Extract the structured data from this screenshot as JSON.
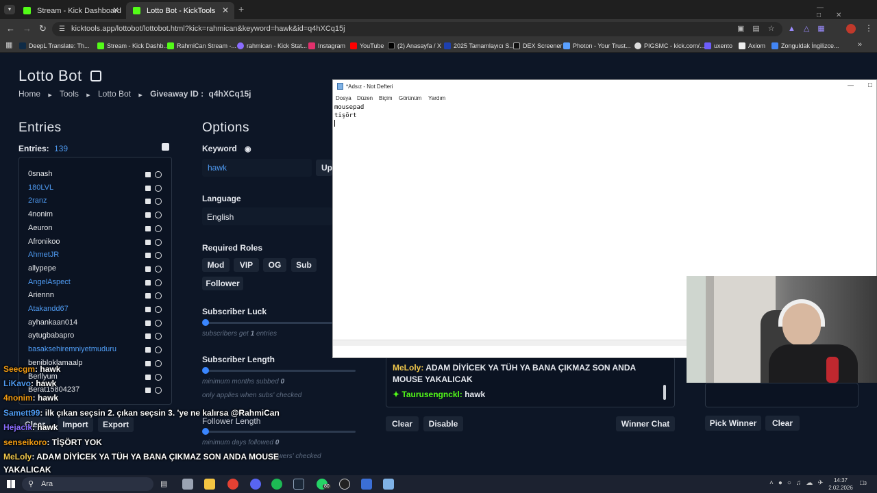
{
  "browser": {
    "tabs": [
      {
        "label": "Stream - Kick Dashboard"
      },
      {
        "label": "Lotto Bot - KickTools"
      }
    ],
    "url": "kicktools.app/lottobot/lottobot.html?kick=rahmican&keyword=hawk&id=q4hXCq15j",
    "bookmarks": [
      "DeepL Translate: Th...",
      "Stream - Kick Dashb...",
      "RahmiCan Stream -...",
      "rahmican - Kick Stat...",
      "Instagram",
      "YouTube",
      "(2) Anasayfa / X",
      "2025 Tamamlayıcı S...",
      "DEX Screener",
      "Photon - Your Trust...",
      "PIGSMC - kick.com/...",
      "uxento",
      "Axiom",
      "Zonguldak İngilizce..."
    ]
  },
  "app": {
    "title": "Lotto Bot",
    "breadcrumb": {
      "home": "Home",
      "tools": "Tools",
      "lotto": "Lotto Bot",
      "giveaway_label": "Giveaway ID :",
      "giveaway_id": "q4hXCq15j"
    },
    "entries": {
      "heading": "Entries",
      "count_label": "Entries:",
      "count": "139",
      "list": [
        {
          "name": "0snash",
          "blue": false
        },
        {
          "name": "180LVL",
          "blue": true
        },
        {
          "name": "2ranz",
          "blue": true
        },
        {
          "name": "4nonim",
          "blue": false
        },
        {
          "name": "Aeuron",
          "blue": false
        },
        {
          "name": "Afronikoo",
          "blue": false
        },
        {
          "name": "AhmetJR",
          "blue": true
        },
        {
          "name": "allypepe",
          "blue": false
        },
        {
          "name": "AngelAspect",
          "blue": true
        },
        {
          "name": "Ariennn",
          "blue": false
        },
        {
          "name": "Atakandd67",
          "blue": true
        },
        {
          "name": "ayhankaan014",
          "blue": false
        },
        {
          "name": "aytugbabapro",
          "blue": false
        },
        {
          "name": "basaksehiremniyetmuduru",
          "blue": true
        },
        {
          "name": "benibloklamaalp",
          "blue": false
        },
        {
          "name": "Berllyum",
          "blue": false
        },
        {
          "name": "Berat15804237",
          "blue": false
        }
      ],
      "buttons": {
        "clear": "Clear",
        "import": "Import",
        "export": "Export"
      }
    },
    "options": {
      "heading": "Options",
      "keyword_label": "Keyword",
      "keyword_value": "hawk",
      "update_label": "Up",
      "language_label": "Language",
      "language_value": "English",
      "roles_label": "Required Roles",
      "roles": [
        "Mod",
        "VIP",
        "OG",
        "Sub",
        "Follower"
      ],
      "sub_luck_label": "Subscriber Luck",
      "sub_luck_hint_pre": "subscribers get",
      "sub_luck_value": "1",
      "sub_luck_hint_post": "entries",
      "sub_length_label": "Subscriber Length",
      "sub_length_hint": "minimum months subbed",
      "sub_length_value": "0",
      "sub_length_hint2": "only applies when subs' checked",
      "follower_length_label": "Follower Length",
      "follower_length_hint": "minimum days followed",
      "follower_length_value": "0",
      "follower_length_hint2": "flowers' checked"
    },
    "chat": {
      "msg1_user": "MeLoly:",
      "msg1_text": "ADAM DİYİCEK YA TÜH YA BANA ÇIKMAZ SON ANDA MOUSE YAKALICAK",
      "msg2_user": "Taurusengnckl:",
      "msg2_text": "hawk",
      "buttons": {
        "clear": "Clear",
        "disable": "Disable",
        "winner_chat": "Winner Chat"
      }
    },
    "winner": {
      "pick": "Pick Winner",
      "clear": "Clear"
    }
  },
  "notepad": {
    "title": "*Adsız - Not Defteri",
    "menu": [
      "Dosya",
      "Düzen",
      "Biçim",
      "Görünüm",
      "Yardım"
    ],
    "lines": [
      "mousepad",
      "tişört"
    ]
  },
  "overlay_chat": [
    {
      "user": "Seecgm",
      "text": ": hawk"
    },
    {
      "user": "LiKavo",
      "text": ": hawk"
    },
    {
      "user": "4nonim",
      "text": ": hawk"
    },
    {
      "user": "Samett99",
      "text": ": ilk çıkan seçsin 2. çıkan seçsin 3. 'ye ne kalırsa @RahmiCan"
    },
    {
      "user": "Hejacik",
      "text": ": hawk"
    },
    {
      "user": "senseikoro",
      "text": ": TİŞÖRT YOK"
    },
    {
      "user": "MeLoly",
      "text": ": ADAM DİYİCEK YA TÜH YA BANA ÇIKMAZ SON ANDA MOUSE"
    },
    {
      "user": "",
      "text": "YAKALICAK"
    }
  ],
  "taskbar": {
    "search": "Ara",
    "time": "14:37",
    "date": "2.02.2026",
    "badge": "80",
    "notif": "3"
  },
  "colors": {
    "kick_green": "#53fc18",
    "accent_blue": "#3a86ff",
    "page_bg": "#0d1626"
  }
}
